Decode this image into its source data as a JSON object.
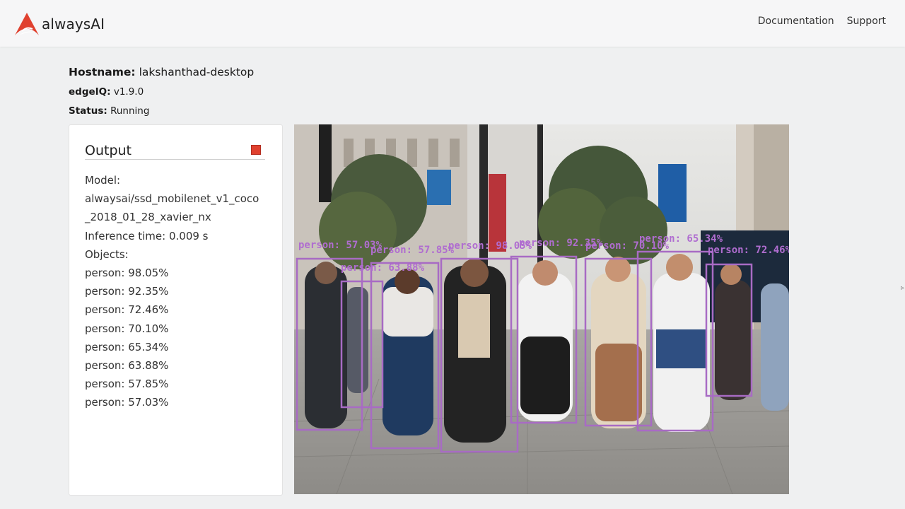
{
  "header": {
    "brand": "alwaysAI",
    "nav": [
      "Documentation",
      "Support"
    ]
  },
  "info": {
    "hostname_label": "Hostname:",
    "hostname_value": "lakshanthad-desktop",
    "edgeiq_label": "edgeIQ:",
    "edgeiq_value": "v1.9.0",
    "status_label": "Status:",
    "status_value": "Running"
  },
  "output": {
    "title": "Output",
    "model_label": "Model:",
    "model_value": "alwaysai/ssd_mobilenet_v1_coco_2018_01_28_xavier_nx",
    "inference": "Inference time: 0.009 s",
    "objects_label": "Objects:",
    "objects": [
      "person: 98.05%",
      "person: 92.35%",
      "person: 72.46%",
      "person: 70.10%",
      "person: 65.34%",
      "person: 63.88%",
      "person: 57.85%",
      "person: 57.03%"
    ]
  },
  "detections": [
    {
      "label": "person: 57.03%"
    },
    {
      "label": "person: 63.88%"
    },
    {
      "label": "person: 57.85%"
    },
    {
      "label": "person: 98.05%"
    },
    {
      "label": "person: 92.35%"
    },
    {
      "label": "person: 70.10%"
    },
    {
      "label": "person: 65.34%"
    },
    {
      "label": "person: 72.46%"
    }
  ],
  "colors": {
    "accent": "#e0412f",
    "box": "#a86bc4",
    "background": "#eff0f1"
  }
}
